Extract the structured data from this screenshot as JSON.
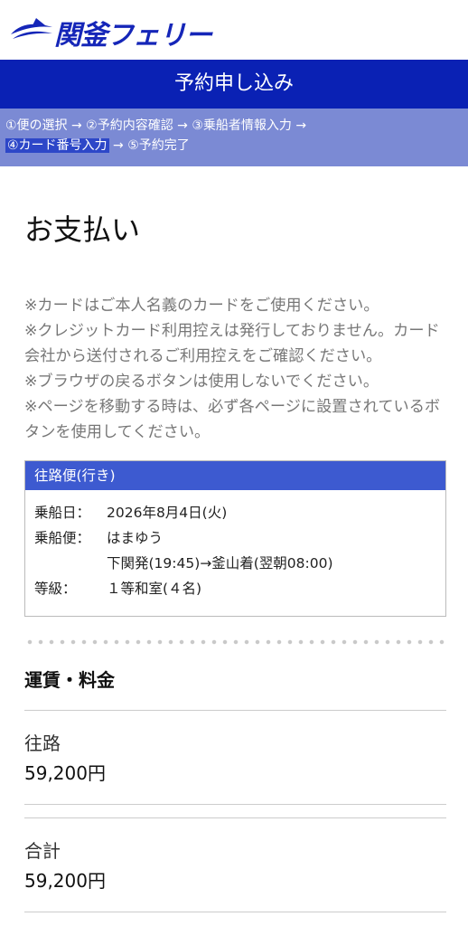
{
  "header": {
    "logo_text": "関釜フェリー",
    "title": "予約申し込み"
  },
  "steps": {
    "line1": "①便の選択 → ②予約内容確認 → ③乗船者情報入力 →",
    "current": "④カード番号入力",
    "after_current": " → ⑤予約完了"
  },
  "page": {
    "heading": "お支払い"
  },
  "notes": [
    "※カードはご本人名義のカードをご使用ください。",
    "※クレジットカード利用控えは発行しておりません。カード会社から送付されるご利用控えをご確認ください。",
    "※ブラウザの戻るボタンは使用しないでください。",
    "※ページを移動する時は、必ず各ページに設置されているボタンを使用してください。"
  ],
  "trip": {
    "header": "往路便(行き)",
    "date_label": "乗船日：",
    "date_value": "2026年8月4日(火)",
    "ship_label": "乗船便：",
    "ship_value": "はまゆう",
    "route_value": "下関発(19:45)→釜山着(翌朝08:00)",
    "class_label": "等級：",
    "class_value": "１等和室(４名)"
  },
  "fare": {
    "heading": "運賃・料金",
    "outbound_label": "往路",
    "outbound_amount": "59,200円",
    "total_label": "合計",
    "total_amount": "59,200円"
  },
  "colors": {
    "brand": "#0a21b4",
    "steps_bg": "#7b8ad4",
    "trip_header": "#3d5ad0"
  }
}
